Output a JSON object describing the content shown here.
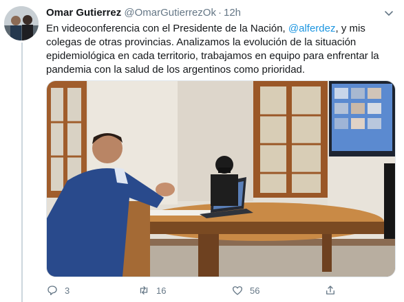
{
  "author": {
    "name": "Omar Gutierrez",
    "handle": "@OmarGutierrezOk",
    "separator": "·",
    "time": "12h"
  },
  "tweet": {
    "text_before": "En videoconferencia con el Presidente de la Nación, ",
    "mention": "@alferdez",
    "text_after": ", y mis colegas de otras provincias. Analizamos la evolución de la situación epidemiológica en cada territorio, trabajamos en equipo para enfrentar la pandemia con la salud de los argentinos como prioridad."
  },
  "actions": {
    "reply_count": "3",
    "retweet_count": "16",
    "like_count": "56"
  },
  "icons": {
    "more": "chevron-down-icon",
    "reply": "reply-icon",
    "retweet": "retweet-icon",
    "like": "heart-icon",
    "share": "share-icon"
  },
  "colors": {
    "link": "#1b95e0",
    "secondary_text": "#657786",
    "primary_text": "#14171a"
  }
}
